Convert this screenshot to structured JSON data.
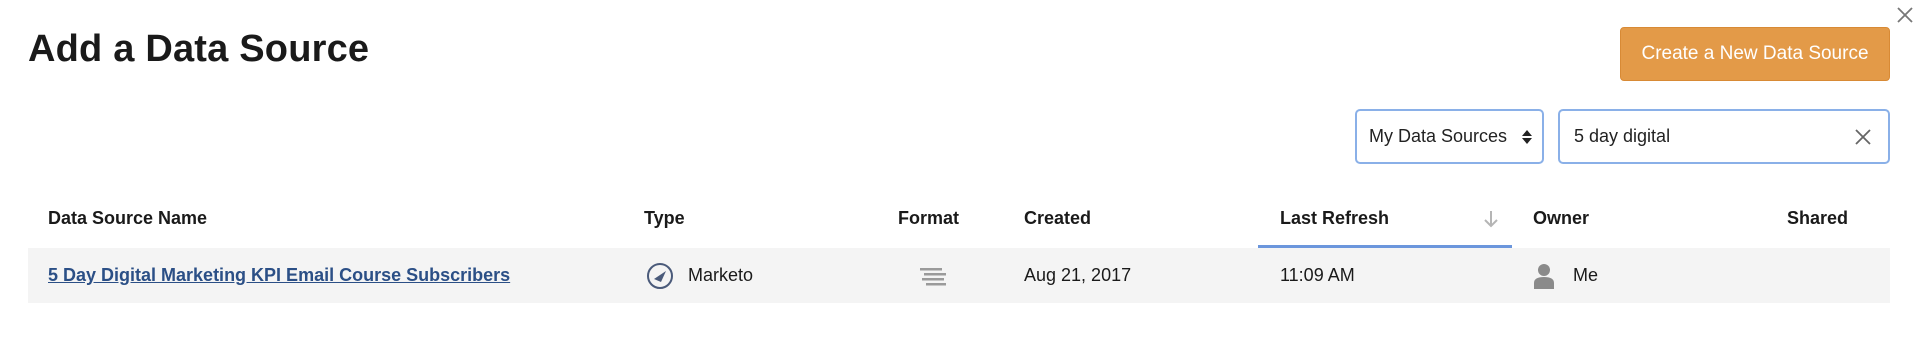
{
  "dialog": {
    "title": "Add a Data Source",
    "close_icon": "close-icon"
  },
  "toolbar": {
    "create_button_label": "Create a New Data Source",
    "filter_select_value": "My Data Sources",
    "search_value": "5 day digital",
    "colors": {
      "accent": "#e39a48",
      "focus_border": "#8ab0e8"
    }
  },
  "table": {
    "columns": {
      "name": "Data Source Name",
      "type": "Type",
      "format": "Format",
      "created": "Created",
      "last_refresh": "Last Refresh",
      "owner": "Owner",
      "shared": "Shared"
    },
    "sort": {
      "column": "last_refresh",
      "direction": "descending",
      "icon": "arrow-down-icon"
    },
    "rows": [
      {
        "name": "5 Day Digital Marketing KPI Email Course Subscribers",
        "type_icon": "marketo-icon",
        "type": "Marketo",
        "format_icon": "format-lines-icon",
        "created": "Aug 21, 2017",
        "last_refresh": "11:09 AM",
        "owner_icon": "person-icon",
        "owner": "Me",
        "shared": ""
      }
    ]
  }
}
